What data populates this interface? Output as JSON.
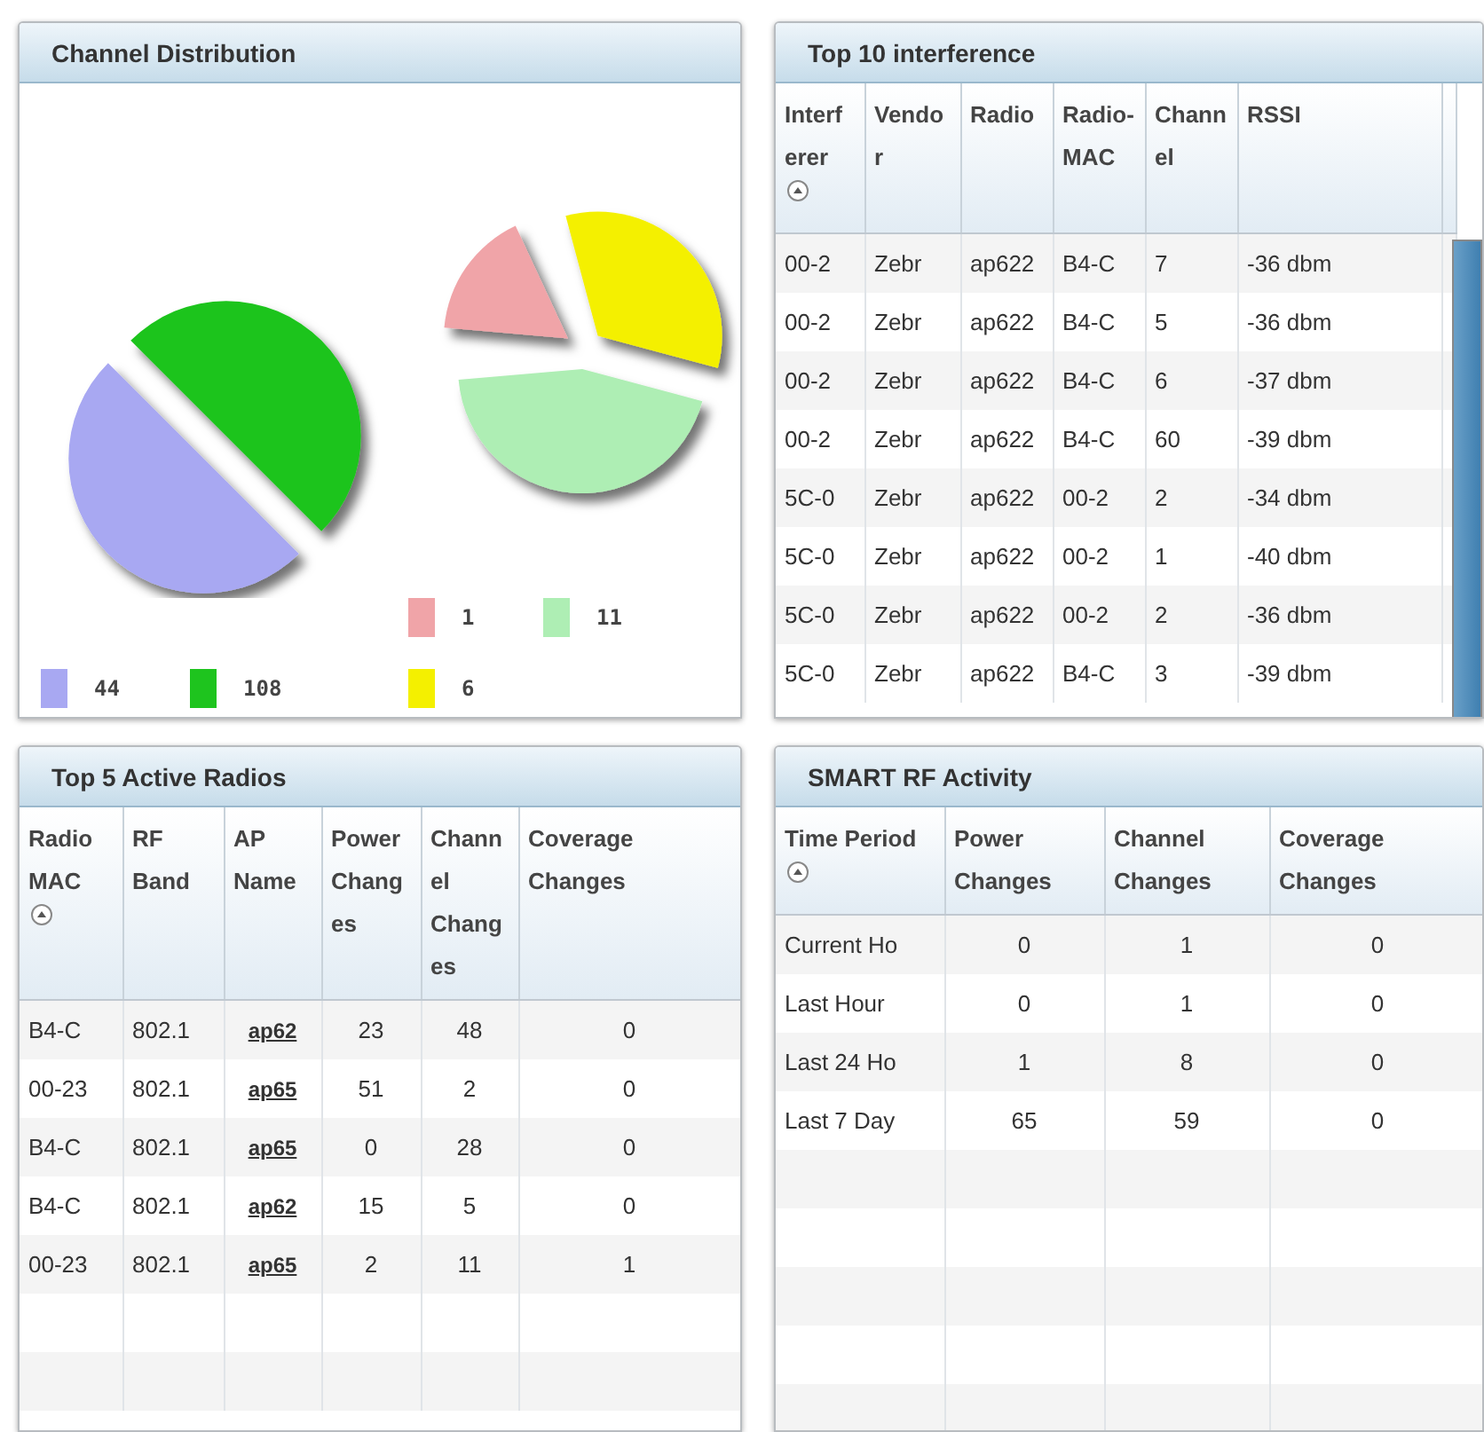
{
  "channel_distribution": {
    "title": "Channel Distribution",
    "pies": [
      {
        "slices": [
          {
            "label": "44",
            "color": "#a8a8f2"
          },
          {
            "label": "108",
            "color": "#1ec41e"
          }
        ]
      },
      {
        "slices": [
          {
            "label": "1",
            "color": "#f0a4a8"
          },
          {
            "label": "11",
            "color": "#aeeeb4"
          },
          {
            "label": "6",
            "color": "#f4f000"
          }
        ]
      }
    ]
  },
  "top_interference": {
    "title": "Top 10 interference",
    "columns": [
      {
        "label": "Interferer",
        "sorted": true
      },
      {
        "label": "Vendor",
        "sorted": false
      },
      {
        "label": "Radio",
        "sorted": false
      },
      {
        "label": "Radio-MAC",
        "sorted": false
      },
      {
        "label": "Channel",
        "sorted": false
      },
      {
        "label": "RSSI",
        "sorted": false
      }
    ],
    "rows": [
      [
        "00-2",
        "Zebr",
        "ap622",
        "B4-C",
        "7",
        "-36 dbm"
      ],
      [
        "00-2",
        "Zebr",
        "ap622",
        "B4-C",
        "5",
        "-36 dbm"
      ],
      [
        "00-2",
        "Zebr",
        "ap622",
        "B4-C",
        "6",
        "-37 dbm"
      ],
      [
        "00-2",
        "Zebr",
        "ap622",
        "B4-C",
        "60",
        "-39 dbm"
      ],
      [
        "5C-0",
        "Zebr",
        "ap622",
        "00-2",
        "2",
        "-34 dbm"
      ],
      [
        "5C-0",
        "Zebr",
        "ap622",
        "00-2",
        "1",
        "-40 dbm"
      ],
      [
        "5C-0",
        "Zebr",
        "ap622",
        "00-2",
        "2",
        "-36 dbm"
      ],
      [
        "5C-0",
        "Zebr",
        "ap622",
        "B4-C",
        "3",
        "-39 dbm"
      ]
    ]
  },
  "top_active_radios": {
    "title": "Top 5 Active Radios",
    "columns": [
      {
        "label": "Radio MAC",
        "sorted": true,
        "link": false
      },
      {
        "label": "RF Band",
        "sorted": false,
        "link": false
      },
      {
        "label": "AP Name",
        "sorted": false,
        "link": true
      },
      {
        "label": "Power Changes",
        "sorted": false,
        "link": false
      },
      {
        "label": "Channel Changes",
        "sorted": false,
        "link": false
      },
      {
        "label": "Coverage Changes",
        "sorted": false,
        "link": false
      }
    ],
    "rows": [
      [
        "B4-C",
        "802.1",
        "ap62",
        "23",
        "48",
        "0"
      ],
      [
        "00-23",
        "802.1",
        "ap65",
        "51",
        "2",
        "0"
      ],
      [
        "B4-C",
        "802.1",
        "ap65",
        "0",
        "28",
        "0"
      ],
      [
        "B4-C",
        "802.1",
        "ap62",
        "15",
        "5",
        "0"
      ],
      [
        "00-23",
        "802.1",
        "ap65",
        "2",
        "11",
        "1"
      ]
    ]
  },
  "smart_rf_activity": {
    "title": "SMART RF Activity",
    "columns": [
      {
        "label": "Time Period",
        "sorted": true
      },
      {
        "label": "Power Changes",
        "sorted": false
      },
      {
        "label": "Channel Changes",
        "sorted": false
      },
      {
        "label": "Coverage Changes",
        "sorted": false
      }
    ],
    "rows": [
      [
        "Current Ho",
        "0",
        "1",
        "0"
      ],
      [
        "Last Hour",
        "0",
        "1",
        "0"
      ],
      [
        "Last 24 Ho",
        "1",
        "8",
        "0"
      ],
      [
        "Last 7 Day",
        "65",
        "59",
        "0"
      ]
    ]
  }
}
